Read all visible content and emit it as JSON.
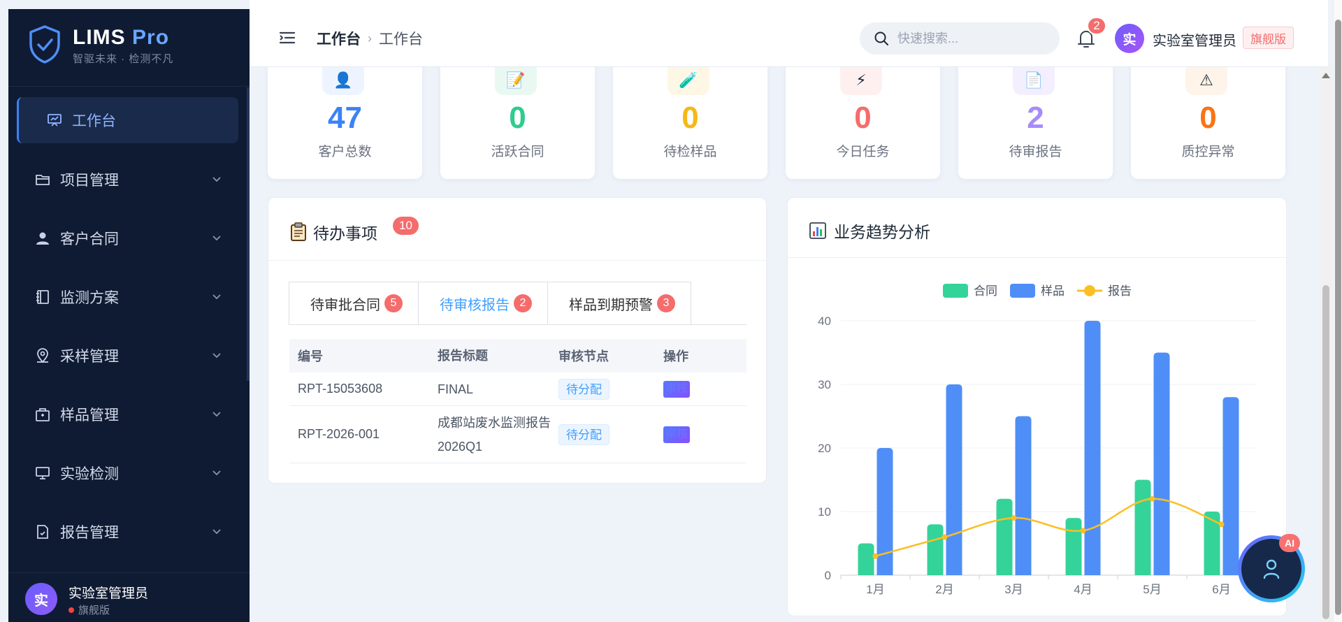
{
  "sidebar": {
    "brand": "LIMS",
    "brand_suffix": "Pro",
    "slogan": "智驱未来 · 检测不凡",
    "items": [
      {
        "label": "工作台",
        "icon": "dashboard-icon",
        "active": true
      },
      {
        "label": "项目管理",
        "icon": "folder-icon"
      },
      {
        "label": "客户合同",
        "icon": "user-icon"
      },
      {
        "label": "监测方案",
        "icon": "notebook-icon"
      },
      {
        "label": "采样管理",
        "icon": "location-icon"
      },
      {
        "label": "样品管理",
        "icon": "box-icon"
      },
      {
        "label": "实验检测",
        "icon": "monitor-icon"
      },
      {
        "label": "报告管理",
        "icon": "document-check-icon"
      }
    ],
    "user": {
      "avatar": "实",
      "name": "实验室管理员",
      "role": "旗舰版"
    }
  },
  "header": {
    "breadcrumb": [
      "工作台",
      "工作台"
    ],
    "search_placeholder": "快速搜索...",
    "notifications": "2",
    "avatar": "实",
    "user": "实验室管理员",
    "edition": "旗舰版"
  },
  "stats": [
    {
      "value": "47",
      "label": "客户总数",
      "color": "#3b82f6",
      "icon": "👤",
      "bg": "#eef4ff"
    },
    {
      "value": "0",
      "label": "活跃合同",
      "color": "#2ecc8f",
      "icon": "📝",
      "bg": "#e9f9f1"
    },
    {
      "value": "0",
      "label": "待检样品",
      "color": "#f5b818",
      "icon": "🧪",
      "bg": "#fff7e6"
    },
    {
      "value": "0",
      "label": "今日任务",
      "color": "#f56c6c",
      "icon": "⚡",
      "bg": "#fff0f0"
    },
    {
      "value": "2",
      "label": "待审报告",
      "color": "#a78bfa",
      "icon": "📄",
      "bg": "#f3efff"
    },
    {
      "value": "0",
      "label": "质控异常",
      "color": "#f97316",
      "icon": "⚠",
      "bg": "#fff4ea"
    }
  ],
  "todo": {
    "title": "待办事项",
    "count": "10",
    "tabs": [
      {
        "label": "待审批合同",
        "count": "5"
      },
      {
        "label": "待审核报告",
        "count": "2",
        "active": true
      },
      {
        "label": "样品到期预警",
        "count": "3"
      }
    ],
    "columns": [
      "编号",
      "报告标题",
      "审核节点",
      "操作"
    ],
    "rows": [
      {
        "id": "RPT-15053608",
        "title": "FINAL",
        "node": "待分配",
        "action": "审核"
      },
      {
        "id": "RPT-2026-001",
        "title": "成都站废水监测报告2026Q1",
        "node": "待分配",
        "action": "审核"
      }
    ]
  },
  "chart_panel": {
    "title": "业务趋势分析"
  },
  "chart_data": {
    "type": "bar",
    "categories": [
      "1月",
      "2月",
      "3月",
      "4月",
      "5月",
      "6月"
    ],
    "series": [
      {
        "name": "合同",
        "type": "bar",
        "color": "#34d399",
        "values": [
          5,
          8,
          12,
          9,
          15,
          10
        ]
      },
      {
        "name": "样品",
        "type": "bar",
        "color": "#4f8ef7",
        "values": [
          20,
          30,
          25,
          40,
          35,
          28
        ]
      },
      {
        "name": "报告",
        "type": "line",
        "color": "#fbbf24",
        "values": [
          3,
          6,
          9,
          7,
          12,
          8
        ]
      }
    ],
    "yticks": [
      0,
      10,
      20,
      30,
      40
    ],
    "ylim": [
      0,
      40
    ],
    "legend": "top-center",
    "grid": true
  },
  "ai_badge": "AI"
}
